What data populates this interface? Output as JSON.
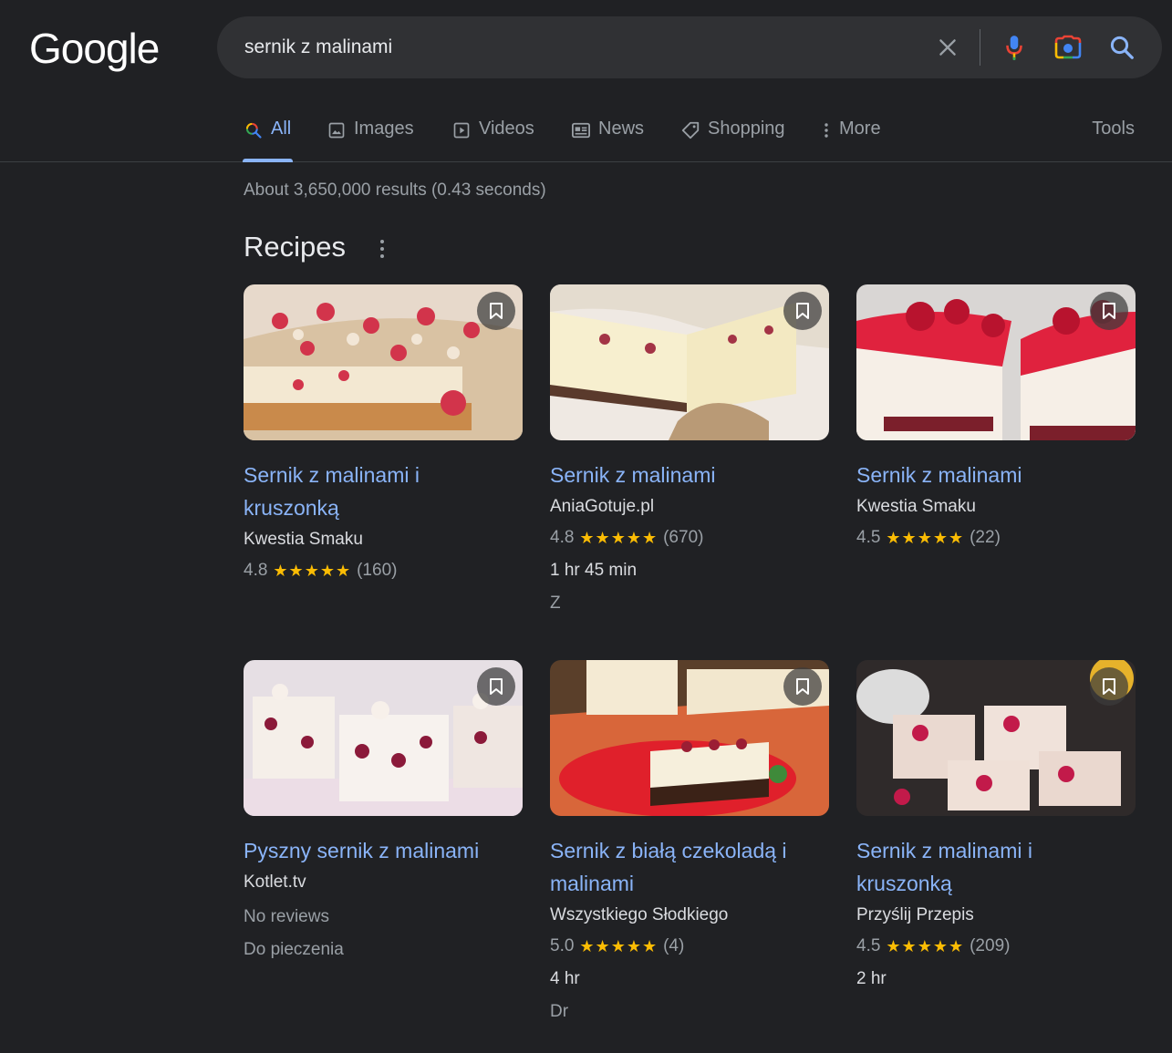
{
  "logo": "Google",
  "search": {
    "query": "sernik z malinami"
  },
  "tabs": [
    {
      "label": "All",
      "icon": "search-icon",
      "active": true
    },
    {
      "label": "Images",
      "icon": "image-icon",
      "active": false
    },
    {
      "label": "Videos",
      "icon": "play-icon",
      "active": false
    },
    {
      "label": "News",
      "icon": "news-icon",
      "active": false
    },
    {
      "label": "Shopping",
      "icon": "tag-icon",
      "active": false
    },
    {
      "label": "More",
      "icon": "more-vert-icon",
      "active": false
    }
  ],
  "tools_label": "Tools",
  "results_stats": "About 3,650,000 results (0.43 seconds)",
  "recipes": {
    "title": "Recipes",
    "cards": [
      {
        "title": "Sernik z malinami i kruszonką",
        "source": "Kwestia Smaku",
        "rating": "4.8",
        "stars": "★★★★★",
        "reviews": "(160)",
        "extra1": "",
        "extra2": ""
      },
      {
        "title": "Sernik z malinami",
        "source": "AniaGotuje.pl",
        "rating": "4.8",
        "stars": "★★★★★",
        "reviews": "(670)",
        "extra1": "1 hr 45 min",
        "extra2": "Z"
      },
      {
        "title": "Sernik z malinami",
        "source": "Kwestia Smaku",
        "rating": "4.5",
        "stars": "★★★★★",
        "reviews": "(22)",
        "extra1": "",
        "extra2": ""
      },
      {
        "title": "Pyszny sernik z malinami",
        "source": "Kotlet.tv",
        "no_reviews": "No reviews",
        "extra1": "Do pieczenia"
      },
      {
        "title": "Sernik z białą czekoladą i malinami",
        "source": "Wszystkiego Słodkiego",
        "rating": "5.0",
        "stars": "★★★★★",
        "reviews": "(4)",
        "extra1": "4 hr",
        "extra2": "Dr"
      },
      {
        "title": "Sernik z malinami i kruszonką",
        "source": "Przyślij Przepis",
        "rating": "4.5",
        "stars": "★★★★★",
        "reviews": "(209)",
        "extra1": "2 hr",
        "extra2": ""
      }
    ]
  },
  "colors": {
    "background": "#202124",
    "link": "#8ab4f8",
    "star": "#fbbc04",
    "muted": "#9aa0a6"
  }
}
